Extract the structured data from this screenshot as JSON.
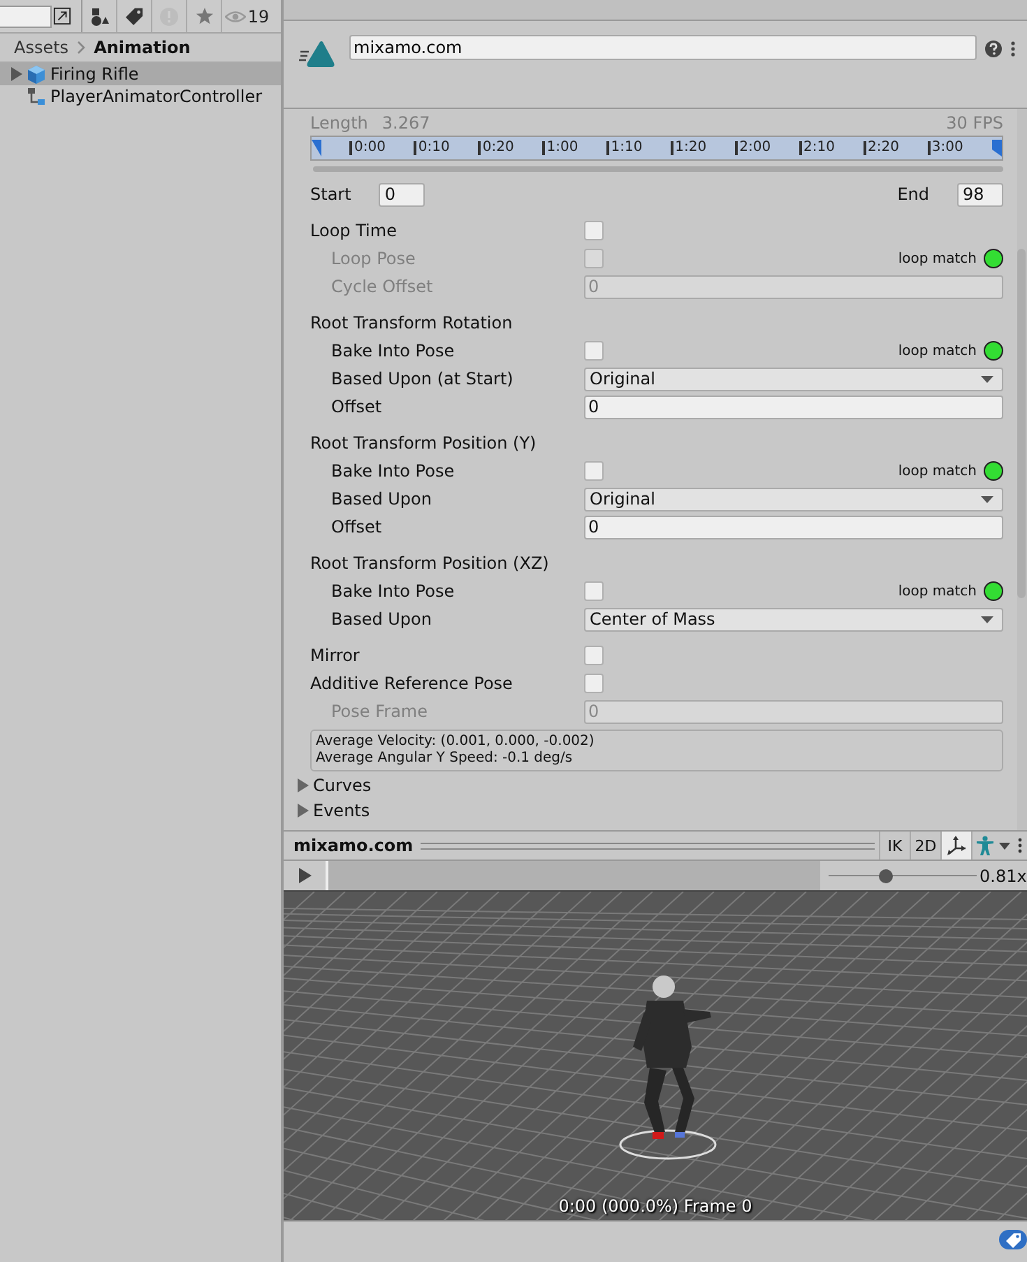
{
  "project": {
    "hidden_count": "19",
    "breadcrumb": [
      "Assets",
      "Animation"
    ],
    "items": [
      {
        "label": "Firing Rifle",
        "kind": "model",
        "expanded": false,
        "selected": true
      },
      {
        "label": "PlayerAnimatorController",
        "kind": "controller",
        "selected": false
      }
    ]
  },
  "inspector": {
    "name": "mixamo.com",
    "clip": {
      "length_label": "Length",
      "length": "3.267",
      "fps": "30 FPS",
      "ticks": [
        "0:00",
        "0:10",
        "0:20",
        "1:00",
        "1:10",
        "1:20",
        "2:00",
        "2:10",
        "2:20",
        "3:00"
      ],
      "start_label": "Start",
      "start": "0",
      "end_label": "End",
      "end": "98"
    },
    "settings": [
      {
        "kind": "checkbox",
        "label": "Loop Time",
        "checked": false,
        "disabled": false,
        "children": [
          {
            "kind": "checkbox",
            "label": "Loop Pose",
            "checked": false,
            "disabled": true,
            "loop_match": {
              "label": "loop match",
              "color": "#33dd33"
            }
          },
          {
            "kind": "number",
            "label": "Cycle Offset",
            "value": "0",
            "disabled": true
          }
        ]
      },
      {
        "kind": "section",
        "label": "Root Transform Rotation",
        "children": [
          {
            "kind": "checkbox",
            "label": "Bake Into Pose",
            "checked": false,
            "disabled": false,
            "loop_match": {
              "label": "loop match",
              "color": "#33dd33"
            }
          },
          {
            "kind": "dropdown",
            "label": "Based Upon (at Start)",
            "value": "Original"
          },
          {
            "kind": "number",
            "label": "Offset",
            "value": "0",
            "disabled": false
          }
        ]
      },
      {
        "kind": "section",
        "label": "Root Transform Position (Y)",
        "children": [
          {
            "kind": "checkbox",
            "label": "Bake Into Pose",
            "checked": false,
            "disabled": false,
            "loop_match": {
              "label": "loop match",
              "color": "#33dd33"
            }
          },
          {
            "kind": "dropdown",
            "label": "Based Upon",
            "value": "Original"
          },
          {
            "kind": "number",
            "label": "Offset",
            "value": "0",
            "disabled": false
          }
        ]
      },
      {
        "kind": "section",
        "label": "Root Transform Position (XZ)",
        "children": [
          {
            "kind": "checkbox",
            "label": "Bake Into Pose",
            "checked": false,
            "disabled": false,
            "loop_match": {
              "label": "loop match",
              "color": "#33dd33"
            }
          },
          {
            "kind": "dropdown",
            "label": "Based Upon",
            "value": "Center of Mass"
          }
        ]
      },
      {
        "kind": "group",
        "children": [
          {
            "kind": "checkbox",
            "label": "Mirror",
            "checked": false,
            "disabled": false
          },
          {
            "kind": "checkbox",
            "label": "Additive Reference Pose",
            "checked": false,
            "disabled": false,
            "children": [
              {
                "kind": "number",
                "label": "Pose Frame",
                "value": "0",
                "disabled": true
              }
            ]
          }
        ]
      }
    ],
    "info": [
      "Average Velocity: (0.001, 0.000, -0.002)",
      "Average Angular Y Speed: -0.1 deg/s"
    ],
    "foldouts": [
      {
        "label": "Curves",
        "expanded": false
      },
      {
        "label": "Events",
        "expanded": false
      }
    ]
  },
  "preview": {
    "title": "mixamo.com",
    "buttons": [
      {
        "kind": "text",
        "label": "IK",
        "selected": false
      },
      {
        "kind": "text",
        "label": "2D",
        "selected": false
      },
      {
        "kind": "pivot",
        "selected": true
      },
      {
        "kind": "avatar",
        "selected": false
      }
    ],
    "speed": {
      "level": 0.39,
      "reading": "0.81x"
    },
    "status": "0:00 (000.0%) Frame 0"
  }
}
